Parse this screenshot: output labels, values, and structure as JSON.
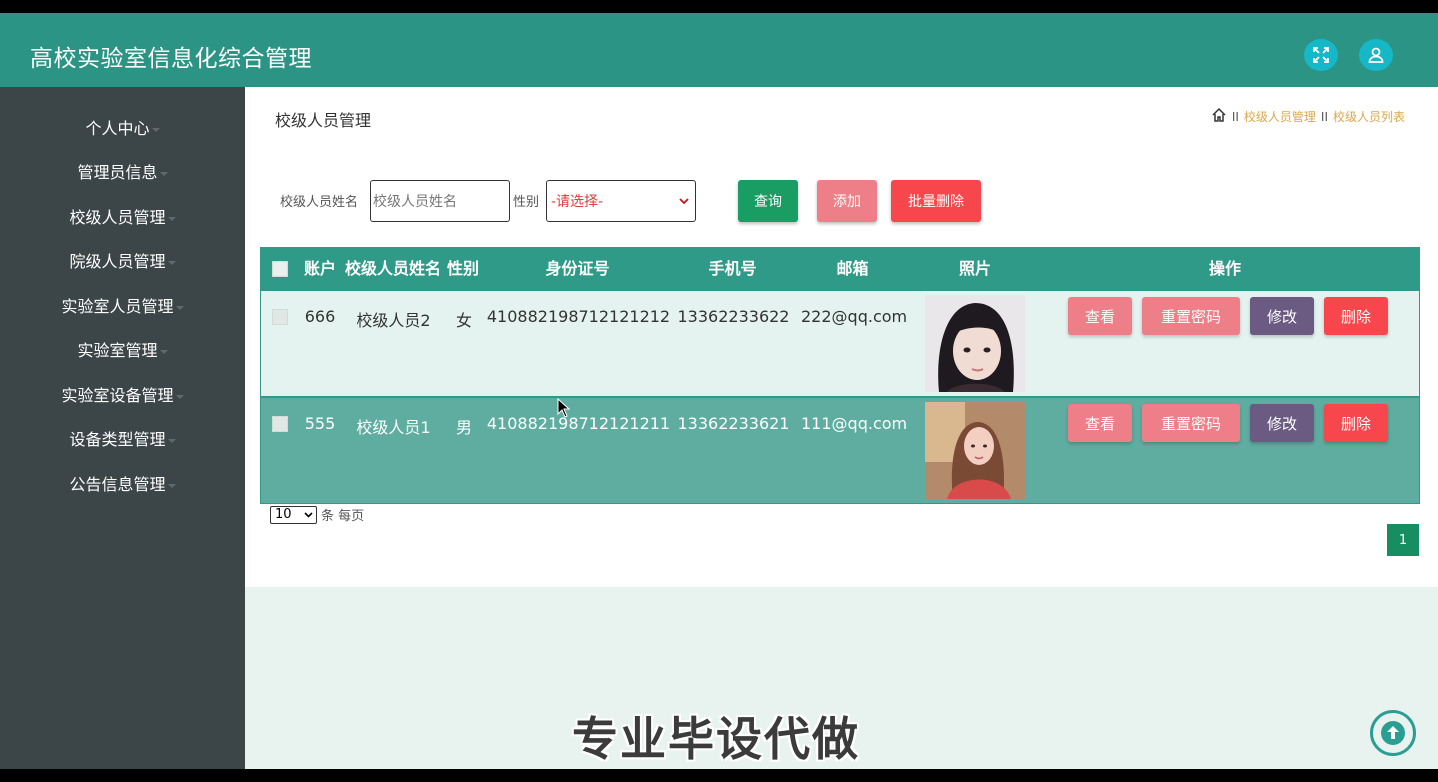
{
  "app": {
    "title": "高校实验室信息化综合管理"
  },
  "header_icons": [
    "fullscreen-icon",
    "user-icon"
  ],
  "sidebar": {
    "items": [
      {
        "label": "个人中心"
      },
      {
        "label": "管理员信息"
      },
      {
        "label": "校级人员管理"
      },
      {
        "label": "院级人员管理"
      },
      {
        "label": "实验室人员管理"
      },
      {
        "label": "实验室管理"
      },
      {
        "label": "实验室设备管理"
      },
      {
        "label": "设备类型管理"
      },
      {
        "label": "公告信息管理"
      }
    ]
  },
  "page": {
    "title": "校级人员管理",
    "breadcrumb": [
      "校级人员管理",
      "校级人员列表"
    ],
    "breadcrumb_separator": "II"
  },
  "search": {
    "name_label": "校级人员姓名",
    "name_placeholder": "校级人员姓名",
    "gender_label": "性别",
    "gender_value": "-请选择-",
    "query_label": "查询",
    "add_label": "添加",
    "batch_delete_label": "批量删除"
  },
  "table": {
    "headers": [
      "账户",
      "校级人员姓名",
      "性别",
      "身份证号",
      "手机号",
      "邮箱",
      "照片",
      "操作"
    ],
    "rows": [
      {
        "account": "666",
        "name": "校级人员2",
        "gender": "女",
        "id_number": "410882198712121212",
        "phone": "13362233622",
        "email": "222@qq.com"
      },
      {
        "account": "555",
        "name": "校级人员1",
        "gender": "男",
        "id_number": "410882198712121211",
        "phone": "13362233621",
        "email": "111@qq.com"
      }
    ],
    "actions": {
      "view": "查看",
      "reset_password": "重置密码",
      "edit": "修改",
      "delete": "删除"
    }
  },
  "pagination": {
    "page_size": "10",
    "page_size_suffix": "条 每页",
    "current_page": "1"
  },
  "watermark": "专业毕设代做",
  "colors": {
    "header": "#2b9485",
    "sidebar": "#3c4649",
    "table_header": "#2f9a87",
    "query_button": "#1a9d63",
    "add_button": "#ee7f88",
    "batch_delete_button": "#f8464d",
    "edit_button": "#6b5a82",
    "delete_button": "#f8464d",
    "breadcrumb": "#d9a84e"
  }
}
